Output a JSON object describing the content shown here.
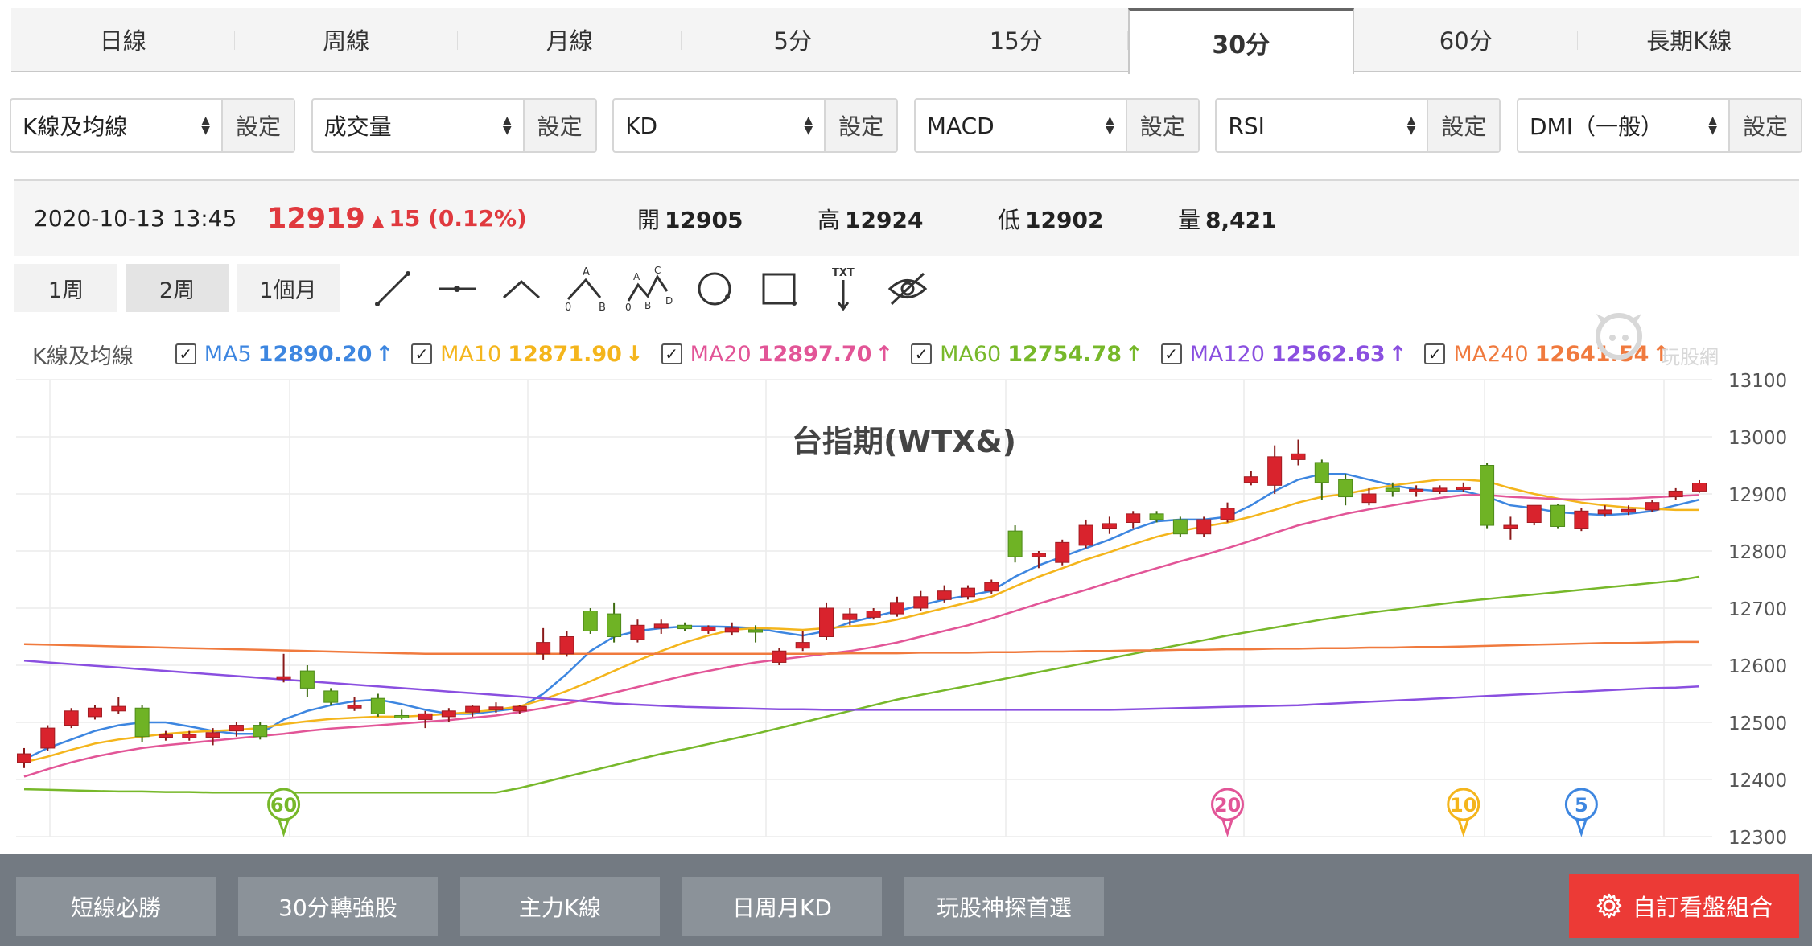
{
  "tabs": [
    {
      "label": "日線"
    },
    {
      "label": "周線"
    },
    {
      "label": "月線"
    },
    {
      "label": "5分"
    },
    {
      "label": "15分"
    },
    {
      "label": "30分",
      "active": true
    },
    {
      "label": "60分"
    },
    {
      "label": "長期K線"
    }
  ],
  "selectors": [
    {
      "value": "K線及均線",
      "button": "設定"
    },
    {
      "value": "成交量",
      "button": "設定"
    },
    {
      "value": "KD",
      "button": "設定"
    },
    {
      "value": "MACD",
      "button": "設定"
    },
    {
      "value": "RSI",
      "button": "設定"
    },
    {
      "value": "DMI（一般）",
      "button": "設定"
    }
  ],
  "quote": {
    "datetime": "2020-10-13 13:45",
    "price": "12919",
    "change": "15 (0.12%)",
    "open_label": "開",
    "open": "12905",
    "high_label": "高",
    "high": "12924",
    "low_label": "低",
    "low": "12902",
    "volume_label": "量",
    "volume": "8,421",
    "up_color": "#e0393e"
  },
  "periods": [
    {
      "label": "1周"
    },
    {
      "label": "2周",
      "active": true
    },
    {
      "label": "1個月"
    }
  ],
  "tools": [
    "line-tool-icon",
    "horizontal-line-icon",
    "angle-line-icon",
    "abc-pattern-icon",
    "abcd-pattern-icon",
    "circle-tool-icon",
    "rectangle-tool-icon",
    "text-tool-icon",
    "hide-drawings-icon"
  ],
  "ma_legend": {
    "title": "K線及均線",
    "items": [
      {
        "name": "MA5",
        "value": "12890.20",
        "arrow": "↑",
        "color": "#3d86e0"
      },
      {
        "name": "MA10",
        "value": "12871.90",
        "arrow": "↓",
        "color": "#f4b51c"
      },
      {
        "name": "MA20",
        "value": "12897.70",
        "arrow": "↑",
        "color": "#e25597"
      },
      {
        "name": "MA60",
        "value": "12754.78",
        "arrow": "↑",
        "color": "#77b82a"
      },
      {
        "name": "MA120",
        "value": "12562.63",
        "arrow": "↑",
        "color": "#8a4fe0"
      },
      {
        "name": "MA240",
        "value": "12641.54",
        "arrow": "↑",
        "color": "#f07a3e"
      }
    ]
  },
  "logo": {
    "text": "玩股網"
  },
  "chart_data": {
    "type": "candlestick",
    "title": "台指期(WTX&)",
    "ylim": [
      12300,
      13100
    ],
    "yticks": [
      "13100",
      "13000",
      "12900",
      "12800",
      "12700",
      "12600",
      "12500",
      "12400",
      "12300"
    ],
    "up_color": "#d9232d",
    "down_color": "#6fb325",
    "candles": [
      {
        "o": 12430,
        "h": 12455,
        "l": 12420,
        "c": 12445
      },
      {
        "o": 12455,
        "h": 12495,
        "l": 12450,
        "c": 12490
      },
      {
        "o": 12495,
        "h": 12525,
        "l": 12490,
        "c": 12520
      },
      {
        "o": 12510,
        "h": 12530,
        "l": 12505,
        "c": 12525
      },
      {
        "o": 12520,
        "h": 12545,
        "l": 12515,
        "c": 12528
      },
      {
        "o": 12525,
        "h": 12530,
        "l": 12465,
        "c": 12475
      },
      {
        "o": 12475,
        "h": 12485,
        "l": 12468,
        "c": 12478
      },
      {
        "o": 12473,
        "h": 12485,
        "l": 12468,
        "c": 12479
      },
      {
        "o": 12474,
        "h": 12490,
        "l": 12460,
        "c": 12482
      },
      {
        "o": 12485,
        "h": 12500,
        "l": 12475,
        "c": 12495
      },
      {
        "o": 12495,
        "h": 12500,
        "l": 12470,
        "c": 12475
      },
      {
        "o": 12578,
        "h": 12620,
        "l": 12570,
        "c": 12580
      },
      {
        "o": 12590,
        "h": 12600,
        "l": 12545,
        "c": 12560
      },
      {
        "o": 12555,
        "h": 12560,
        "l": 12530,
        "c": 12535
      },
      {
        "o": 12525,
        "h": 12545,
        "l": 12520,
        "c": 12530
      },
      {
        "o": 12542,
        "h": 12550,
        "l": 12510,
        "c": 12515
      },
      {
        "o": 12512,
        "h": 12522,
        "l": 12505,
        "c": 12510
      },
      {
        "o": 12505,
        "h": 12520,
        "l": 12490,
        "c": 12515
      },
      {
        "o": 12510,
        "h": 12525,
        "l": 12500,
        "c": 12520
      },
      {
        "o": 12518,
        "h": 12530,
        "l": 12510,
        "c": 12528
      },
      {
        "o": 12522,
        "h": 12535,
        "l": 12517,
        "c": 12527
      },
      {
        "o": 12520,
        "h": 12530,
        "l": 12515,
        "c": 12528
      },
      {
        "o": 12620,
        "h": 12665,
        "l": 12610,
        "c": 12640
      },
      {
        "o": 12620,
        "h": 12660,
        "l": 12615,
        "c": 12650
      },
      {
        "o": 12695,
        "h": 12700,
        "l": 12655,
        "c": 12660
      },
      {
        "o": 12690,
        "h": 12710,
        "l": 12640,
        "c": 12650
      },
      {
        "o": 12645,
        "h": 12680,
        "l": 12640,
        "c": 12670
      },
      {
        "o": 12665,
        "h": 12680,
        "l": 12655,
        "c": 12672
      },
      {
        "o": 12670,
        "h": 12675,
        "l": 12660,
        "c": 12664
      },
      {
        "o": 12660,
        "h": 12670,
        "l": 12655,
        "c": 12667
      },
      {
        "o": 12658,
        "h": 12675,
        "l": 12652,
        "c": 12665
      },
      {
        "o": 12662,
        "h": 12670,
        "l": 12640,
        "c": 12660
      },
      {
        "o": 12605,
        "h": 12630,
        "l": 12600,
        "c": 12625
      },
      {
        "o": 12630,
        "h": 12660,
        "l": 12625,
        "c": 12640
      },
      {
        "o": 12650,
        "h": 12710,
        "l": 12645,
        "c": 12700
      },
      {
        "o": 12680,
        "h": 12700,
        "l": 12670,
        "c": 12690
      },
      {
        "o": 12684,
        "h": 12700,
        "l": 12680,
        "c": 12695
      },
      {
        "o": 12690,
        "h": 12720,
        "l": 12685,
        "c": 12710
      },
      {
        "o": 12700,
        "h": 12730,
        "l": 12695,
        "c": 12720
      },
      {
        "o": 12715,
        "h": 12740,
        "l": 12710,
        "c": 12730
      },
      {
        "o": 12720,
        "h": 12740,
        "l": 12715,
        "c": 12735
      },
      {
        "o": 12730,
        "h": 12750,
        "l": 12725,
        "c": 12745
      },
      {
        "o": 12835,
        "h": 12845,
        "l": 12780,
        "c": 12790
      },
      {
        "o": 12790,
        "h": 12800,
        "l": 12770,
        "c": 12796
      },
      {
        "o": 12780,
        "h": 12820,
        "l": 12775,
        "c": 12815
      },
      {
        "o": 12810,
        "h": 12855,
        "l": 12805,
        "c": 12845
      },
      {
        "o": 12840,
        "h": 12860,
        "l": 12830,
        "c": 12848
      },
      {
        "o": 12850,
        "h": 12870,
        "l": 12840,
        "c": 12865
      },
      {
        "o": 12865,
        "h": 12870,
        "l": 12850,
        "c": 12855
      },
      {
        "o": 12855,
        "h": 12860,
        "l": 12825,
        "c": 12830
      },
      {
        "o": 12830,
        "h": 12860,
        "l": 12825,
        "c": 12855
      },
      {
        "o": 12855,
        "h": 12885,
        "l": 12850,
        "c": 12875
      },
      {
        "o": 12920,
        "h": 12940,
        "l": 12915,
        "c": 12930
      },
      {
        "o": 12915,
        "h": 12985,
        "l": 12900,
        "c": 12965
      },
      {
        "o": 12960,
        "h": 12995,
        "l": 12950,
        "c": 12970
      },
      {
        "o": 12955,
        "h": 12960,
        "l": 12890,
        "c": 12920
      },
      {
        "o": 12925,
        "h": 12935,
        "l": 12880,
        "c": 12895
      },
      {
        "o": 12885,
        "h": 12910,
        "l": 12880,
        "c": 12900
      },
      {
        "o": 12910,
        "h": 12920,
        "l": 12895,
        "c": 12905
      },
      {
        "o": 12905,
        "h": 12915,
        "l": 12895,
        "c": 12908
      },
      {
        "o": 12905,
        "h": 12915,
        "l": 12900,
        "c": 12910
      },
      {
        "o": 12910,
        "h": 12920,
        "l": 12903,
        "c": 12912
      },
      {
        "o": 12950,
        "h": 12955,
        "l": 12840,
        "c": 12845
      },
      {
        "o": 12840,
        "h": 12860,
        "l": 12820,
        "c": 12845
      },
      {
        "o": 12850,
        "h": 12880,
        "l": 12845,
        "c": 12880
      },
      {
        "o": 12880,
        "h": 12882,
        "l": 12840,
        "c": 12843
      },
      {
        "o": 12840,
        "h": 12875,
        "l": 12835,
        "c": 12870
      },
      {
        "o": 12865,
        "h": 12880,
        "l": 12860,
        "c": 12872
      },
      {
        "o": 12868,
        "h": 12880,
        "l": 12863,
        "c": 12873
      },
      {
        "o": 12872,
        "h": 12890,
        "l": 12868,
        "c": 12885
      },
      {
        "o": 12895,
        "h": 12910,
        "l": 12890,
        "c": 12905
      },
      {
        "o": 12905,
        "h": 12924,
        "l": 12902,
        "c": 12919
      }
    ],
    "ma_lines": [
      {
        "name": "MA5",
        "color": "#3d86e0",
        "values": [
          12435,
          12455,
          12470,
          12485,
          12495,
          12500,
          12500,
          12493,
          12485,
          12480,
          12480,
          12505,
          12520,
          12530,
          12537,
          12540,
          12532,
          12522,
          12515,
          12515,
          12520,
          12525,
          12550,
          12585,
          12625,
          12650,
          12660,
          12665,
          12668,
          12668,
          12667,
          12665,
          12658,
          12652,
          12660,
          12675,
          12685,
          12695,
          12705,
          12715,
          12722,
          12730,
          12755,
          12775,
          12790,
          12805,
          12820,
          12838,
          12852,
          12855,
          12855,
          12860,
          12880,
          12905,
          12925,
          12935,
          12935,
          12925,
          12915,
          12908,
          12905,
          12905,
          12895,
          12880,
          12875,
          12868,
          12865,
          12863,
          12865,
          12870,
          12880,
          12890
        ]
      },
      {
        "name": "MA10",
        "color": "#f4b51c",
        "values": [
          12430,
          12440,
          12452,
          12463,
          12470,
          12475,
          12480,
          12483,
          12485,
          12487,
          12490,
          12497,
          12502,
          12506,
          12508,
          12510,
          12510,
          12512,
          12515,
          12518,
          12522,
          12528,
          12540,
          12555,
          12572,
          12590,
          12608,
          12625,
          12640,
          12652,
          12662,
          12665,
          12664,
          12662,
          12665,
          12668,
          12672,
          12680,
          12690,
          12700,
          12710,
          12720,
          12738,
          12755,
          12770,
          12785,
          12798,
          12812,
          12825,
          12835,
          12843,
          12850,
          12860,
          12872,
          12885,
          12895,
          12900,
          12908,
          12915,
          12920,
          12925,
          12925,
          12922,
          12910,
          12900,
          12892,
          12885,
          12880,
          12876,
          12874,
          12872,
          12872
        ]
      },
      {
        "name": "MA20",
        "color": "#e25597",
        "values": [
          12405,
          12418,
          12430,
          12440,
          12448,
          12455,
          12460,
          12464,
          12468,
          12472,
          12476,
          12480,
          12485,
          12489,
          12492,
          12495,
          12498,
          12501,
          12504,
          12508,
          12512,
          12518,
          12525,
          12533,
          12542,
          12552,
          12562,
          12572,
          12582,
          12590,
          12598,
          12605,
          12610,
          12615,
          12620,
          12625,
          12632,
          12640,
          12650,
          12660,
          12670,
          12682,
          12695,
          12708,
          12720,
          12732,
          12745,
          12758,
          12770,
          12782,
          12793,
          12805,
          12818,
          12832,
          12845,
          12855,
          12865,
          12873,
          12880,
          12887,
          12893,
          12898,
          12898,
          12895,
          12893,
          12891,
          12890,
          12891,
          12892,
          12894,
          12896,
          12898
        ]
      },
      {
        "name": "MA60",
        "color": "#77b82a",
        "values": [
          12383,
          12382,
          12381,
          12380,
          12379,
          12379,
          12378,
          12378,
          12377,
          12377,
          12377,
          12377,
          12377,
          12377,
          12377,
          12377,
          12377,
          12377,
          12377,
          12377,
          12377,
          12385,
          12395,
          12405,
          12415,
          12425,
          12435,
          12445,
          12453,
          12462,
          12471,
          12480,
          12490,
          12500,
          12510,
          12520,
          12530,
          12540,
          12548,
          12556,
          12564,
          12572,
          12580,
          12588,
          12596,
          12604,
          12612,
          12620,
          12628,
          12636,
          12644,
          12652,
          12659,
          12666,
          12673,
          12680,
          12686,
          12692,
          12697,
          12702,
          12707,
          12712,
          12716,
          12720,
          12724,
          12728,
          12732,
          12736,
          12740,
          12744,
          12748,
          12755
        ]
      },
      {
        "name": "MA120",
        "color": "#8a4fe0",
        "values": [
          12608,
          12605,
          12602,
          12599,
          12596,
          12593,
          12590,
          12587,
          12584,
          12581,
          12578,
          12575,
          12572,
          12569,
          12566,
          12563,
          12560,
          12557,
          12554,
          12551,
          12548,
          12545,
          12542,
          12539,
          12536,
          12533,
          12531,
          12529,
          12527,
          12526,
          12525,
          12524,
          12523,
          12523,
          12522,
          12522,
          12522,
          12522,
          12522,
          12522,
          12522,
          12522,
          12522,
          12522,
          12522,
          12522,
          12522,
          12523,
          12524,
          12525,
          12526,
          12527,
          12528,
          12529,
          12530,
          12532,
          12534,
          12536,
          12538,
          12540,
          12542,
          12544,
          12546,
          12548,
          12550,
          12552,
          12554,
          12556,
          12558,
          12560,
          12561,
          12563
        ]
      },
      {
        "name": "MA240",
        "color": "#f07a3e",
        "values": [
          12637,
          12636,
          12635,
          12634,
          12633,
          12632,
          12631,
          12630,
          12629,
          12628,
          12627,
          12626,
          12625,
          12624,
          12623,
          12622,
          12621,
          12620,
          12620,
          12620,
          12620,
          12620,
          12620,
          12620,
          12620,
          12620,
          12620,
          12620,
          12620,
          12620,
          12620,
          12620,
          12620,
          12620,
          12620,
          12621,
          12621,
          12621,
          12622,
          12622,
          12622,
          12623,
          12623,
          12624,
          12624,
          12625,
          12625,
          12626,
          12626,
          12627,
          12627,
          12628,
          12628,
          12629,
          12629,
          12630,
          12630,
          12631,
          12631,
          12632,
          12632,
          12633,
          12634,
          12635,
          12636,
          12637,
          12638,
          12639,
          12639,
          12640,
          12641,
          12641
        ]
      }
    ],
    "markers": [
      {
        "label": "60",
        "index": 11,
        "color": "#77b82a"
      },
      {
        "label": "20",
        "index": 51,
        "color": "#e25597"
      },
      {
        "label": "10",
        "index": 61,
        "color": "#f4b51c"
      },
      {
        "label": "5",
        "index": 66,
        "color": "#3d86e0"
      }
    ]
  },
  "bottom_buttons": [
    {
      "label": "短線必勝"
    },
    {
      "label": "30分轉強股"
    },
    {
      "label": "主力K線"
    },
    {
      "label": "日周月KD"
    },
    {
      "label": "玩股神探首選"
    }
  ],
  "custom_button": {
    "label": "自訂看盤組合"
  }
}
